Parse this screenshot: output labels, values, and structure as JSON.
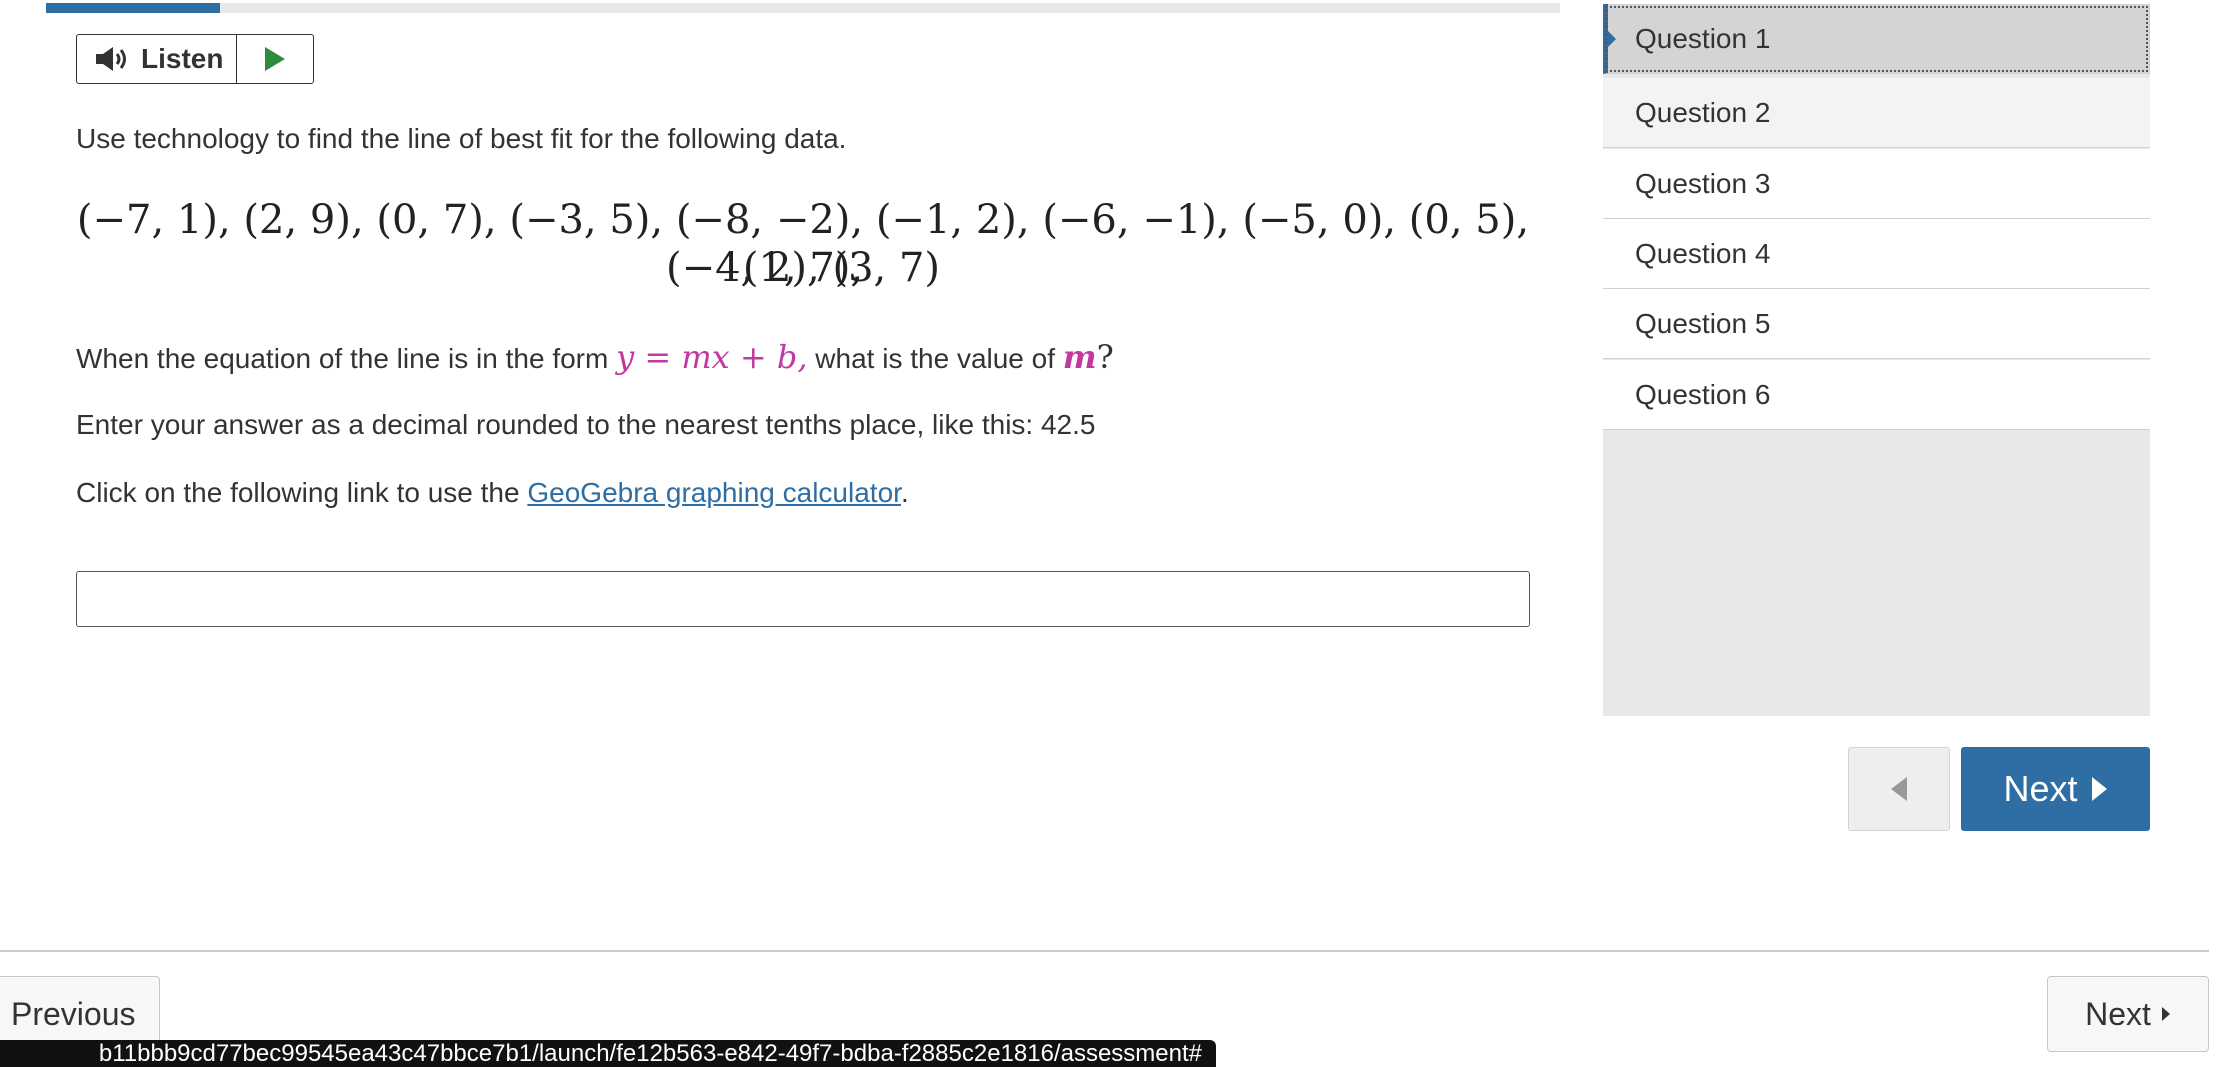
{
  "progress": {
    "fraction": 0.115
  },
  "listen": {
    "label": "Listen",
    "speaker_icon": "speaker-icon",
    "play_icon": "play-icon"
  },
  "question": {
    "intro": "Use technology to find the line of best fit for the following data.",
    "data_line1": "(−7, 1), (2, 9), (0, 7), (−3, 5), (−8, −2), (−1, 2), (−6, −1), (−5, 0), (0, 5), (1, 7),",
    "data_line2": "(−4, 2), (3, 7)",
    "form_prefix": "When the equation of the line is in the form ",
    "form_equation": "y = mx + b,",
    "form_middle": " what is the value of ",
    "form_variable": "m",
    "form_suffix": "?",
    "instructions": "Enter your answer as a decimal rounded to the nearest tenths place, like this: 42.5",
    "link_prefix": "Click on the following link to use the ",
    "link_text": "GeoGebra graphing calculator",
    "link_suffix": ".",
    "answer_value": ""
  },
  "question_list": {
    "items": [
      {
        "label": "Question 1",
        "state": "active"
      },
      {
        "label": "Question 2",
        "state": "hover"
      },
      {
        "label": "Question 3",
        "state": "normal"
      },
      {
        "label": "Question 4",
        "state": "normal"
      },
      {
        "label": "Question 5",
        "state": "normal"
      },
      {
        "label": "Question 6",
        "state": "normal"
      }
    ]
  },
  "nav": {
    "next_label": "Next",
    "previous_bottom_label": "Previous",
    "next_bottom_label": "Next"
  },
  "status_bar": {
    "url": "b11bbb9cd77bec99545ea43c47bbce7b1/launch/fe12b563-e842-49f7-bdba-f2885c2e1816/assessment#"
  },
  "colors": {
    "accent": "#2f6ea5",
    "math_highlight": "#c0399f",
    "panel_bg": "#e8e8e8"
  }
}
